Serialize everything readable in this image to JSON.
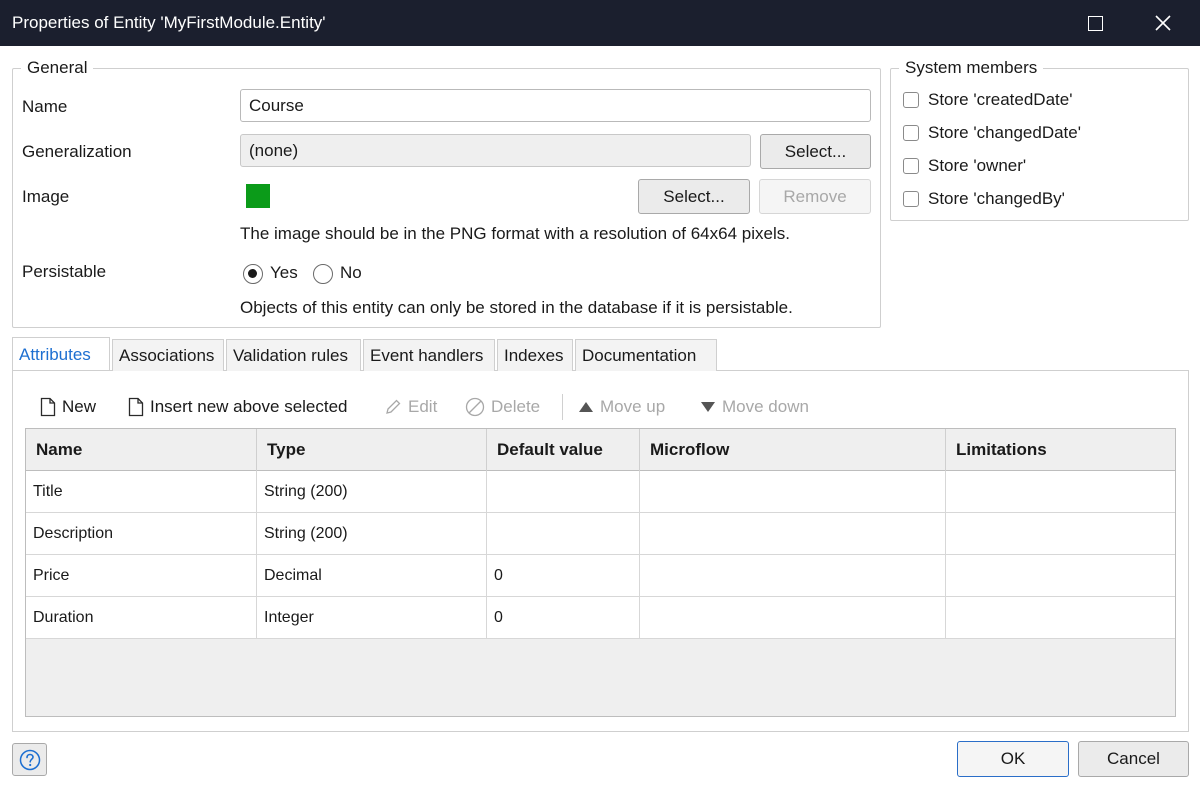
{
  "window": {
    "title": "Properties of Entity 'MyFirstModule.Entity'"
  },
  "general": {
    "legend": "General",
    "name_label": "Name",
    "name_value": "Course",
    "generalization_label": "Generalization",
    "generalization_value": "(none)",
    "generalization_select": "Select...",
    "image_label": "Image",
    "image_select": "Select...",
    "image_remove": "Remove",
    "image_hint": "The image should be in the PNG format with a resolution of 64x64 pixels.",
    "image_color": "#0b9b19",
    "persistable_label": "Persistable",
    "yes_label": "Yes",
    "no_label": "No",
    "persistable_selected": "Yes",
    "persistable_hint": "Objects of this entity can only be stored in the database if it is persistable."
  },
  "system_members": {
    "legend": "System members",
    "items": [
      {
        "label": "Store 'createdDate'",
        "checked": false
      },
      {
        "label": "Store 'changedDate'",
        "checked": false
      },
      {
        "label": "Store 'owner'",
        "checked": false
      },
      {
        "label": "Store 'changedBy'",
        "checked": false
      }
    ]
  },
  "tabs": [
    {
      "label": "Attributes",
      "active": true
    },
    {
      "label": "Associations",
      "active": false
    },
    {
      "label": "Validation rules",
      "active": false
    },
    {
      "label": "Event handlers",
      "active": false
    },
    {
      "label": "Indexes",
      "active": false
    },
    {
      "label": "Documentation",
      "active": false
    }
  ],
  "toolbar": {
    "new": "New",
    "insert": "Insert new above selected",
    "edit": "Edit",
    "delete": "Delete",
    "move_up": "Move up",
    "move_down": "Move down"
  },
  "table": {
    "columns": [
      "Name",
      "Type",
      "Default value",
      "Microflow",
      "Limitations"
    ],
    "rows": [
      [
        "Title",
        "String (200)",
        "",
        "",
        ""
      ],
      [
        "Description",
        "String (200)",
        "",
        "",
        ""
      ],
      [
        "Price",
        "Decimal",
        "0",
        "",
        ""
      ],
      [
        "Duration",
        "Integer",
        "0",
        "",
        ""
      ]
    ]
  },
  "footer": {
    "ok": "OK",
    "cancel": "Cancel"
  },
  "colors": {
    "titlebar": "#1b1f2e",
    "accent": "#1d6fd1"
  }
}
